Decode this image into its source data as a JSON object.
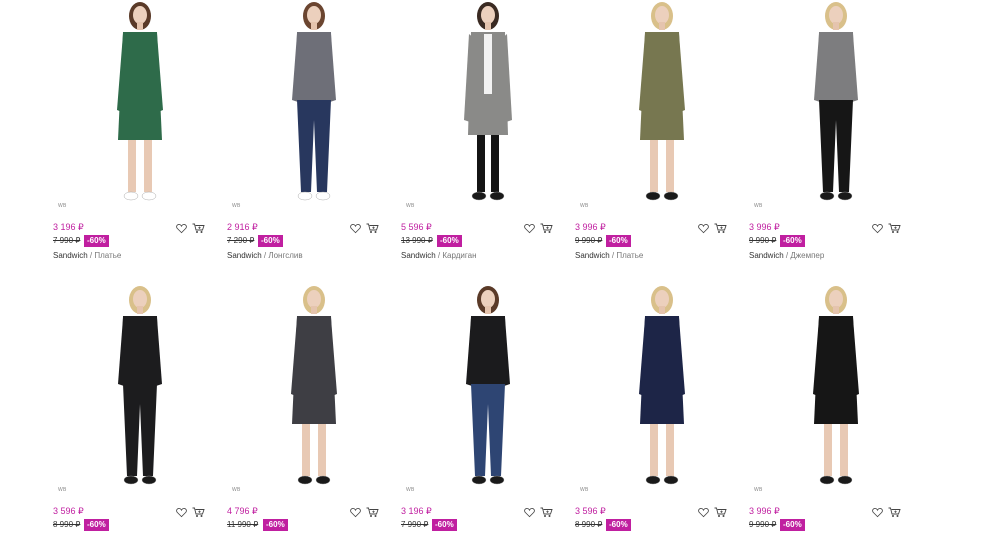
{
  "wb_mark": "WB",
  "colors": {
    "accent": "#c01fa0",
    "text": "#333333",
    "muted": "#777777"
  },
  "products": [
    {
      "price": "3 196 ₽",
      "old_price": "7 990 ₽",
      "discount": "-60%",
      "brand": "Sandwich",
      "category": "Платье",
      "garment": "#2e6b4a",
      "legs": "#e8c9b4",
      "shoes": "#ffffff",
      "hair": "#5a3a28",
      "style": "dress"
    },
    {
      "price": "2 916 ₽",
      "old_price": "7 290 ₽",
      "discount": "-60%",
      "brand": "Sandwich",
      "category": "Лонгслив",
      "garment": "#6e6f78",
      "legs": "#28375e",
      "shoes": "#ffffff",
      "hair": "#6b4530",
      "style": "top"
    },
    {
      "price": "5 596 ₽",
      "old_price": "13 990 ₽",
      "discount": "-60%",
      "brand": "Sandwich",
      "category": "Кардиган",
      "garment": "#8a8a88",
      "legs": "#141414",
      "shoes": "#1a1a1a",
      "hair": "#3a2a22",
      "style": "coat"
    },
    {
      "price": "3 996 ₽",
      "old_price": "9 990 ₽",
      "discount": "-60%",
      "brand": "Sandwich",
      "category": "Платье",
      "garment": "#777750",
      "legs": "#e8c9b4",
      "shoes": "#1a1a1a",
      "hair": "#d9c08a",
      "style": "dress"
    },
    {
      "price": "3 996 ₽",
      "old_price": "9 990 ₽",
      "discount": "-60%",
      "brand": "Sandwich",
      "category": "Джемпер",
      "garment": "#7d7d7f",
      "legs": "#161616",
      "shoes": "#1a1a1a",
      "hair": "#d9c08a",
      "style": "top"
    },
    {
      "price": "3 596 ₽",
      "old_price": "8 990 ₽",
      "discount": "-60%",
      "brand": "",
      "category": "",
      "garment": "#1c1c1e",
      "legs": "#1c1c1e",
      "shoes": "#1a1a1a",
      "hair": "#d9c08a",
      "style": "top"
    },
    {
      "price": "4 796 ₽",
      "old_price": "11 990 ₽",
      "discount": "-60%",
      "brand": "",
      "category": "",
      "garment": "#3e3e44",
      "legs": "#e8c9b4",
      "shoes": "#1a1a1a",
      "hair": "#d9c08a",
      "style": "dress"
    },
    {
      "price": "3 196 ₽",
      "old_price": "7 990 ₽",
      "discount": "-60%",
      "brand": "",
      "category": "",
      "garment": "#1b1b1d",
      "legs": "#2e4573",
      "shoes": "#1a1a1a",
      "hair": "#5a3a28",
      "style": "top"
    },
    {
      "price": "3 596 ₽",
      "old_price": "8 990 ₽",
      "discount": "-60%",
      "brand": "",
      "category": "",
      "garment": "#1d2547",
      "legs": "#e8c9b4",
      "shoes": "#1a1a1a",
      "hair": "#d9c08a",
      "style": "dress"
    },
    {
      "price": "3 996 ₽",
      "old_price": "9 990 ₽",
      "discount": "-60%",
      "brand": "",
      "category": "",
      "garment": "#161616",
      "legs": "#e8c9b4",
      "shoes": "#1a1a1a",
      "hair": "#d9c08a",
      "style": "dress"
    }
  ]
}
